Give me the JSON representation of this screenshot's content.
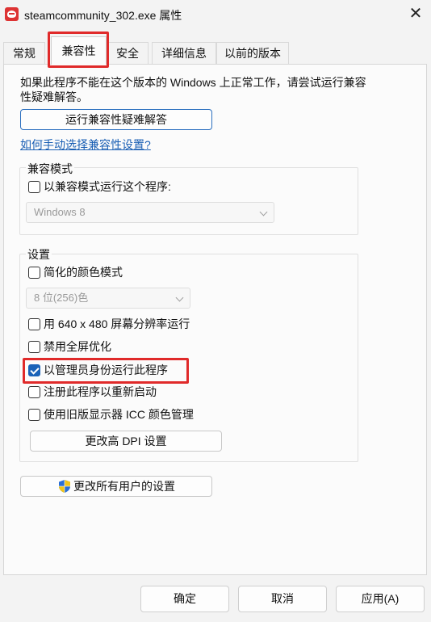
{
  "window": {
    "title": "steamcommunity_302.exe 属性",
    "close_glyph": "✕"
  },
  "tabs": [
    {
      "label": "常规"
    },
    {
      "label": "兼容性"
    },
    {
      "label": "安全"
    },
    {
      "label": "详细信息"
    },
    {
      "label": "以前的版本"
    }
  ],
  "intro_text": "如果此程序不能在这个版本的 Windows 上正常工作，请尝试运行兼容性疑难解答。",
  "troubleshooter_button": "运行兼容性疑难解答",
  "manual_link": "如何手动选择兼容性设置?",
  "compat_mode": {
    "title": "兼容模式",
    "checkbox_label": "以兼容模式运行这个程序:",
    "checked": false,
    "os_select": "Windows 8"
  },
  "settings": {
    "title": "设置",
    "reduced_color": {
      "label": "简化的颜色模式",
      "checked": false
    },
    "color_select": "8 位(256)色",
    "res_640": {
      "label": "用 640 x 480 屏幕分辨率运行",
      "checked": false
    },
    "disable_fullscreen": {
      "label": "禁用全屏优化",
      "checked": false
    },
    "run_as_admin": {
      "label": "以管理员身份运行此程序",
      "checked": true
    },
    "register_restart": {
      "label": "注册此程序以重新启动",
      "checked": false
    },
    "legacy_icc": {
      "label": "使用旧版显示器 ICC 颜色管理",
      "checked": false
    },
    "dpi_button": "更改高 DPI 设置"
  },
  "all_users_button": "更改所有用户的设置",
  "footer": {
    "ok": "确定",
    "cancel": "取消",
    "apply": "应用(A)"
  },
  "colors": {
    "highlight": "#e02a2a",
    "link": "#1a5fb4",
    "checkbox_checked": "#1a62b8"
  }
}
